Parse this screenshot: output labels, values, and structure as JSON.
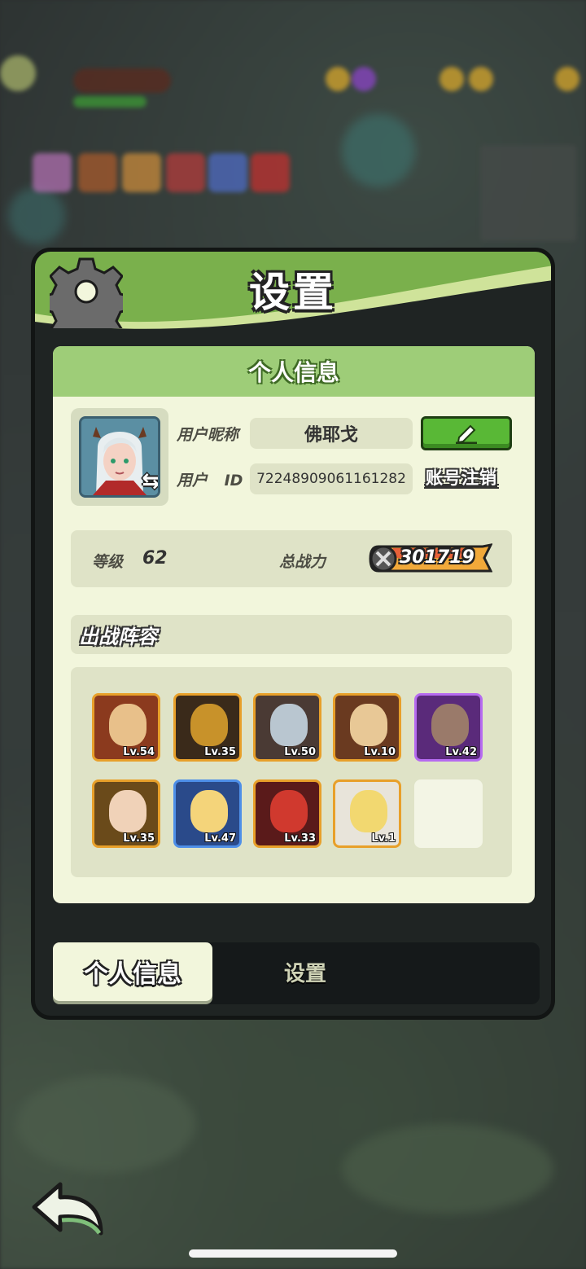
{
  "settings_panel": {
    "title": "设置",
    "section_title": "个人信息",
    "profile": {
      "nickname_label": "用户昵称",
      "nickname": "佛耶戈",
      "id_label": "用户 ID",
      "user_id": "72248909061161282",
      "logout_label": "账号注销",
      "edit_icon": "pencil-icon",
      "swap_icon": "swap-arrows-icon"
    },
    "stats": {
      "level_label": "等级",
      "level": "62",
      "power_label": "总战力",
      "power": "301719"
    },
    "team": {
      "title": "出战阵容",
      "heroes": [
        {
          "level": "Lv.54",
          "rarity": "gold"
        },
        {
          "level": "Lv.35",
          "rarity": "gold"
        },
        {
          "level": "Lv.50",
          "rarity": "gold"
        },
        {
          "level": "Lv.10",
          "rarity": "gold"
        },
        {
          "level": "Lv.42",
          "rarity": "purple"
        },
        {
          "level": "Lv.35",
          "rarity": "gold"
        },
        {
          "level": "Lv.47",
          "rarity": "blue"
        },
        {
          "level": "Lv.33",
          "rarity": "gold"
        },
        {
          "level": "Lv.1",
          "rarity": "gold"
        },
        {
          "level": "",
          "rarity": "empty"
        }
      ]
    },
    "tabs": [
      {
        "label": "个人信息",
        "active": true
      },
      {
        "label": "设置",
        "active": false
      }
    ]
  },
  "colors": {
    "header_green": "#7ab04c",
    "card_bg": "#f2f6dc",
    "edit_button": "#59b836",
    "power_badge": "#f1a93a"
  }
}
